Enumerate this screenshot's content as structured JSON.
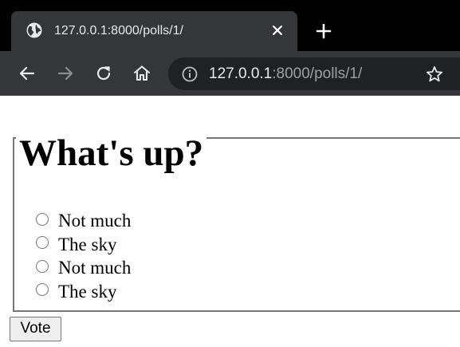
{
  "browser": {
    "tab": {
      "title": "127.0.0.1:8000/polls/1/",
      "icon": "globe-icon"
    },
    "address": {
      "host": "127.0.0.1",
      "rest": ":8000/polls/1/"
    },
    "icons": [
      "back-arrow-icon",
      "forward-arrow-icon",
      "reload-icon",
      "home-icon",
      "info-icon",
      "star-icon",
      "close-icon",
      "plus-icon"
    ],
    "colors": {
      "tabstrip": "#000000",
      "toolbar": "#35363a",
      "omnibox": "#202124"
    }
  },
  "poll": {
    "question": "What's up?",
    "choices": [
      {
        "label": "Not much",
        "selected": false
      },
      {
        "label": "The sky",
        "selected": false
      },
      {
        "label": "Not much",
        "selected": false
      },
      {
        "label": "The sky",
        "selected": false
      }
    ],
    "submit_label": "Vote"
  }
}
